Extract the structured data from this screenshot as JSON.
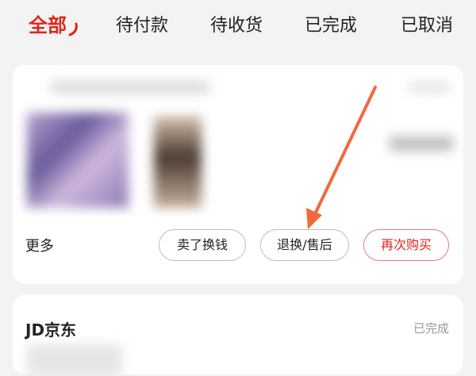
{
  "tabs": [
    {
      "label": "全部",
      "active": true
    },
    {
      "label": "待付款",
      "active": false
    },
    {
      "label": "待收货",
      "active": false
    },
    {
      "label": "已完成",
      "active": false
    },
    {
      "label": "已取消",
      "active": false
    }
  ],
  "order_card": {
    "more_label": "更多",
    "buttons": {
      "sell_label": "卖了换钱",
      "return_label": "退换/售后",
      "rebuy_label": "再次购买"
    }
  },
  "second_card": {
    "store_name": "JD京东",
    "status": "已完成"
  },
  "colors": {
    "accent": "#e2231a",
    "annotation_arrow": "#f06a3b",
    "background": "#f3f3f3"
  },
  "annotation": {
    "icon": "arrow-pointer-icon",
    "target": "return-exchange-button"
  }
}
